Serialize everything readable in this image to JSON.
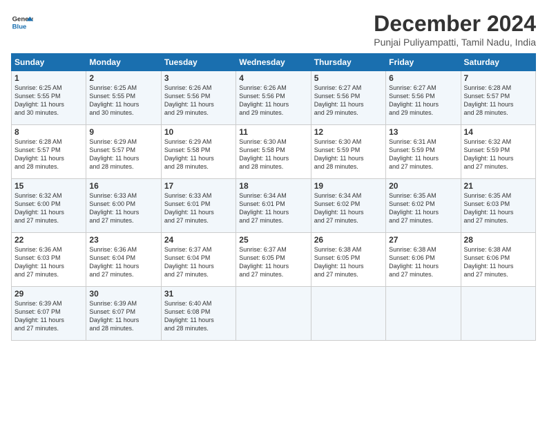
{
  "logo": {
    "line1": "General",
    "line2": "Blue"
  },
  "title": "December 2024",
  "location": "Punjai Puliyampatti, Tamil Nadu, India",
  "headers": [
    "Sunday",
    "Monday",
    "Tuesday",
    "Wednesday",
    "Thursday",
    "Friday",
    "Saturday"
  ],
  "weeks": [
    [
      {
        "day": "1",
        "lines": [
          "Sunrise: 6:25 AM",
          "Sunset: 5:55 PM",
          "Daylight: 11 hours",
          "and 30 minutes."
        ]
      },
      {
        "day": "2",
        "lines": [
          "Sunrise: 6:25 AM",
          "Sunset: 5:55 PM",
          "Daylight: 11 hours",
          "and 30 minutes."
        ]
      },
      {
        "day": "3",
        "lines": [
          "Sunrise: 6:26 AM",
          "Sunset: 5:56 PM",
          "Daylight: 11 hours",
          "and 29 minutes."
        ]
      },
      {
        "day": "4",
        "lines": [
          "Sunrise: 6:26 AM",
          "Sunset: 5:56 PM",
          "Daylight: 11 hours",
          "and 29 minutes."
        ]
      },
      {
        "day": "5",
        "lines": [
          "Sunrise: 6:27 AM",
          "Sunset: 5:56 PM",
          "Daylight: 11 hours",
          "and 29 minutes."
        ]
      },
      {
        "day": "6",
        "lines": [
          "Sunrise: 6:27 AM",
          "Sunset: 5:56 PM",
          "Daylight: 11 hours",
          "and 29 minutes."
        ]
      },
      {
        "day": "7",
        "lines": [
          "Sunrise: 6:28 AM",
          "Sunset: 5:57 PM",
          "Daylight: 11 hours",
          "and 28 minutes."
        ]
      }
    ],
    [
      {
        "day": "8",
        "lines": [
          "Sunrise: 6:28 AM",
          "Sunset: 5:57 PM",
          "Daylight: 11 hours",
          "and 28 minutes."
        ]
      },
      {
        "day": "9",
        "lines": [
          "Sunrise: 6:29 AM",
          "Sunset: 5:57 PM",
          "Daylight: 11 hours",
          "and 28 minutes."
        ]
      },
      {
        "day": "10",
        "lines": [
          "Sunrise: 6:29 AM",
          "Sunset: 5:58 PM",
          "Daylight: 11 hours",
          "and 28 minutes."
        ]
      },
      {
        "day": "11",
        "lines": [
          "Sunrise: 6:30 AM",
          "Sunset: 5:58 PM",
          "Daylight: 11 hours",
          "and 28 minutes."
        ]
      },
      {
        "day": "12",
        "lines": [
          "Sunrise: 6:30 AM",
          "Sunset: 5:59 PM",
          "Daylight: 11 hours",
          "and 28 minutes."
        ]
      },
      {
        "day": "13",
        "lines": [
          "Sunrise: 6:31 AM",
          "Sunset: 5:59 PM",
          "Daylight: 11 hours",
          "and 27 minutes."
        ]
      },
      {
        "day": "14",
        "lines": [
          "Sunrise: 6:32 AM",
          "Sunset: 5:59 PM",
          "Daylight: 11 hours",
          "and 27 minutes."
        ]
      }
    ],
    [
      {
        "day": "15",
        "lines": [
          "Sunrise: 6:32 AM",
          "Sunset: 6:00 PM",
          "Daylight: 11 hours",
          "and 27 minutes."
        ]
      },
      {
        "day": "16",
        "lines": [
          "Sunrise: 6:33 AM",
          "Sunset: 6:00 PM",
          "Daylight: 11 hours",
          "and 27 minutes."
        ]
      },
      {
        "day": "17",
        "lines": [
          "Sunrise: 6:33 AM",
          "Sunset: 6:01 PM",
          "Daylight: 11 hours",
          "and 27 minutes."
        ]
      },
      {
        "day": "18",
        "lines": [
          "Sunrise: 6:34 AM",
          "Sunset: 6:01 PM",
          "Daylight: 11 hours",
          "and 27 minutes."
        ]
      },
      {
        "day": "19",
        "lines": [
          "Sunrise: 6:34 AM",
          "Sunset: 6:02 PM",
          "Daylight: 11 hours",
          "and 27 minutes."
        ]
      },
      {
        "day": "20",
        "lines": [
          "Sunrise: 6:35 AM",
          "Sunset: 6:02 PM",
          "Daylight: 11 hours",
          "and 27 minutes."
        ]
      },
      {
        "day": "21",
        "lines": [
          "Sunrise: 6:35 AM",
          "Sunset: 6:03 PM",
          "Daylight: 11 hours",
          "and 27 minutes."
        ]
      }
    ],
    [
      {
        "day": "22",
        "lines": [
          "Sunrise: 6:36 AM",
          "Sunset: 6:03 PM",
          "Daylight: 11 hours",
          "and 27 minutes."
        ]
      },
      {
        "day": "23",
        "lines": [
          "Sunrise: 6:36 AM",
          "Sunset: 6:04 PM",
          "Daylight: 11 hours",
          "and 27 minutes."
        ]
      },
      {
        "day": "24",
        "lines": [
          "Sunrise: 6:37 AM",
          "Sunset: 6:04 PM",
          "Daylight: 11 hours",
          "and 27 minutes."
        ]
      },
      {
        "day": "25",
        "lines": [
          "Sunrise: 6:37 AM",
          "Sunset: 6:05 PM",
          "Daylight: 11 hours",
          "and 27 minutes."
        ]
      },
      {
        "day": "26",
        "lines": [
          "Sunrise: 6:38 AM",
          "Sunset: 6:05 PM",
          "Daylight: 11 hours",
          "and 27 minutes."
        ]
      },
      {
        "day": "27",
        "lines": [
          "Sunrise: 6:38 AM",
          "Sunset: 6:06 PM",
          "Daylight: 11 hours",
          "and 27 minutes."
        ]
      },
      {
        "day": "28",
        "lines": [
          "Sunrise: 6:38 AM",
          "Sunset: 6:06 PM",
          "Daylight: 11 hours",
          "and 27 minutes."
        ]
      }
    ],
    [
      {
        "day": "29",
        "lines": [
          "Sunrise: 6:39 AM",
          "Sunset: 6:07 PM",
          "Daylight: 11 hours",
          "and 27 minutes."
        ]
      },
      {
        "day": "30",
        "lines": [
          "Sunrise: 6:39 AM",
          "Sunset: 6:07 PM",
          "Daylight: 11 hours",
          "and 28 minutes."
        ]
      },
      {
        "day": "31",
        "lines": [
          "Sunrise: 6:40 AM",
          "Sunset: 6:08 PM",
          "Daylight: 11 hours",
          "and 28 minutes."
        ]
      },
      {
        "day": "",
        "lines": []
      },
      {
        "day": "",
        "lines": []
      },
      {
        "day": "",
        "lines": []
      },
      {
        "day": "",
        "lines": []
      }
    ]
  ]
}
